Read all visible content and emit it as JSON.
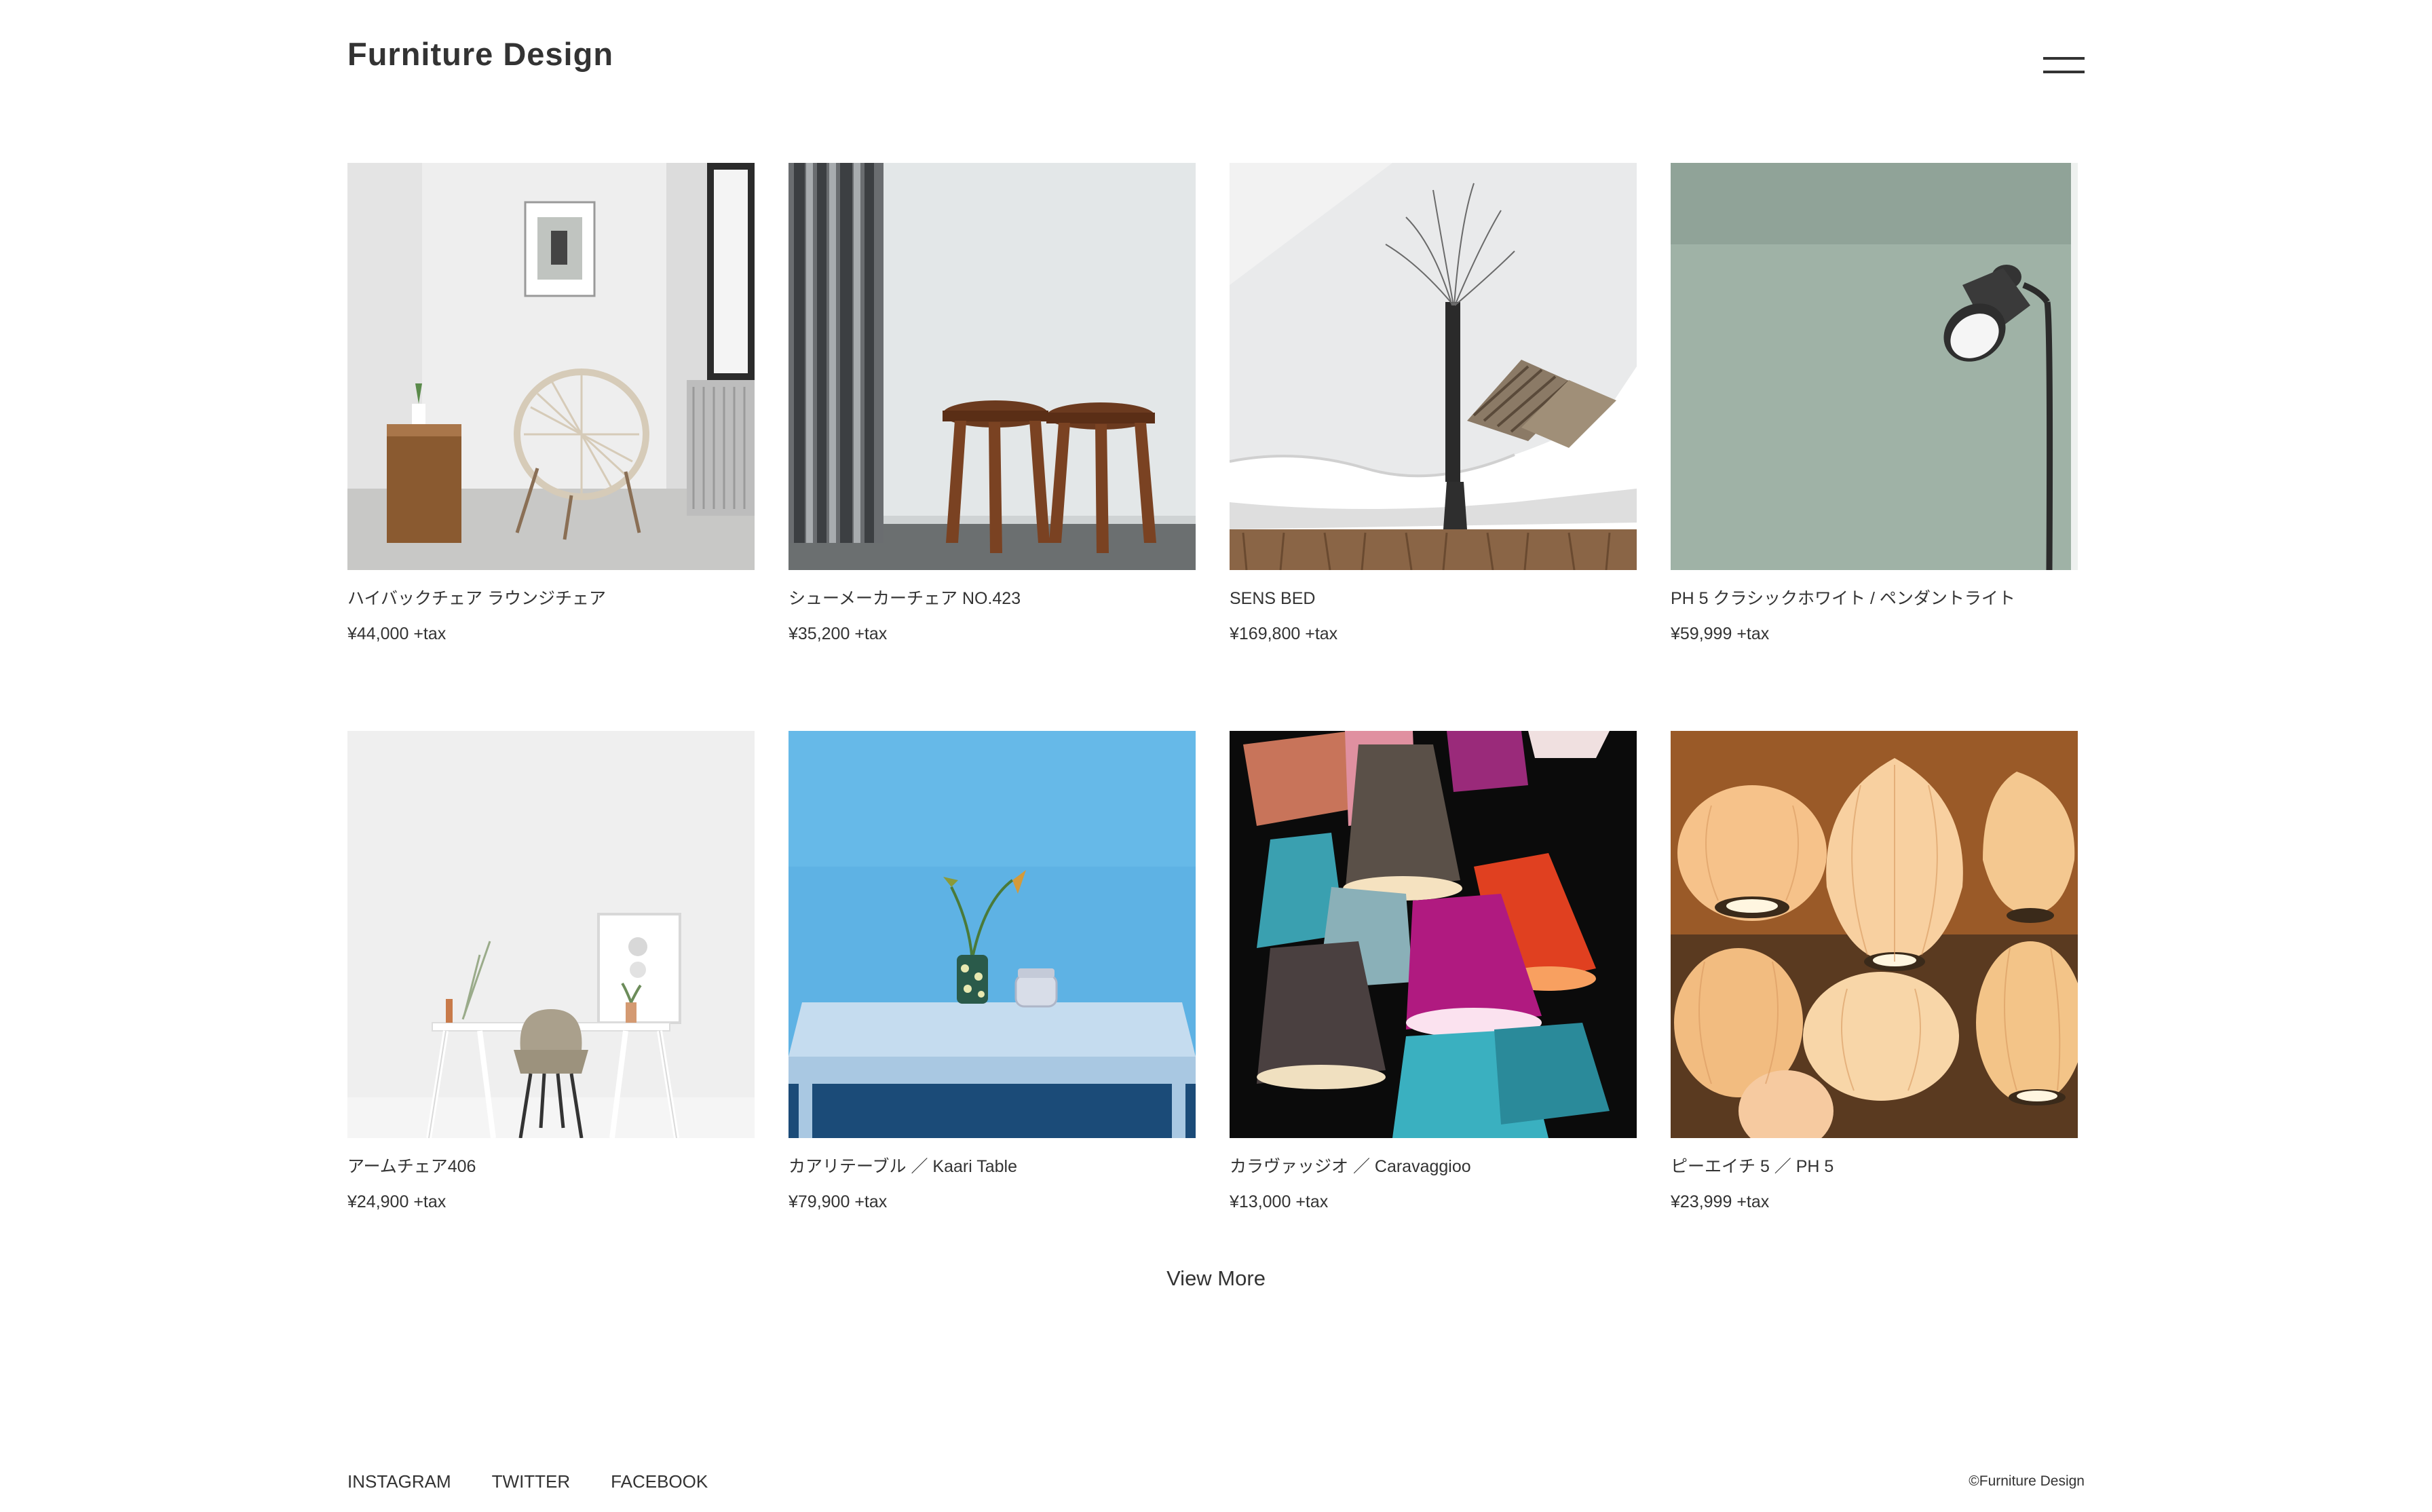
{
  "header": {
    "logo": "Furniture Design",
    "menu_icon": "hamburger-menu-icon"
  },
  "products": [
    {
      "name": "ハイバックチェア ラウンジチェア",
      "price": "¥44,000 +tax",
      "image": "white room with wire lounge chair and wooden stool"
    },
    {
      "name": "シューメーカーチェア NO.423",
      "price": "¥35,200 +tax",
      "image": "two wooden stools beside grey curtain"
    },
    {
      "name": "SENS BED",
      "price": "¥169,800 +tax",
      "image": "white chaise lounge with striped cushions and vase"
    },
    {
      "name": "PH 5 クラシックホワイト / ペンダントライト",
      "price": "¥59,999 +tax",
      "image": "black floor lamp against sage green wall"
    },
    {
      "name": "アームチェア406",
      "price": "¥24,900 +tax",
      "image": "white desk with shell chair and frames"
    },
    {
      "name": "カアリテーブル ／ Kaari Table",
      "price": "¥79,900 +tax",
      "image": "light blue table against blue wall with vase"
    },
    {
      "name": "カラヴァッジオ ／ Caravaggioo",
      "price": "¥13,000 +tax",
      "image": "colorful hanging lamp shades"
    },
    {
      "name": "ピーエイチ 5 ／ PH 5",
      "price": "¥23,999 +tax",
      "image": "glowing bubble pendant lamps"
    }
  ],
  "view_more": "View More",
  "footer": {
    "social": [
      "INSTAGRAM",
      "TWITTER",
      "FACEBOOK"
    ],
    "copyright": "©Furniture Design"
  }
}
